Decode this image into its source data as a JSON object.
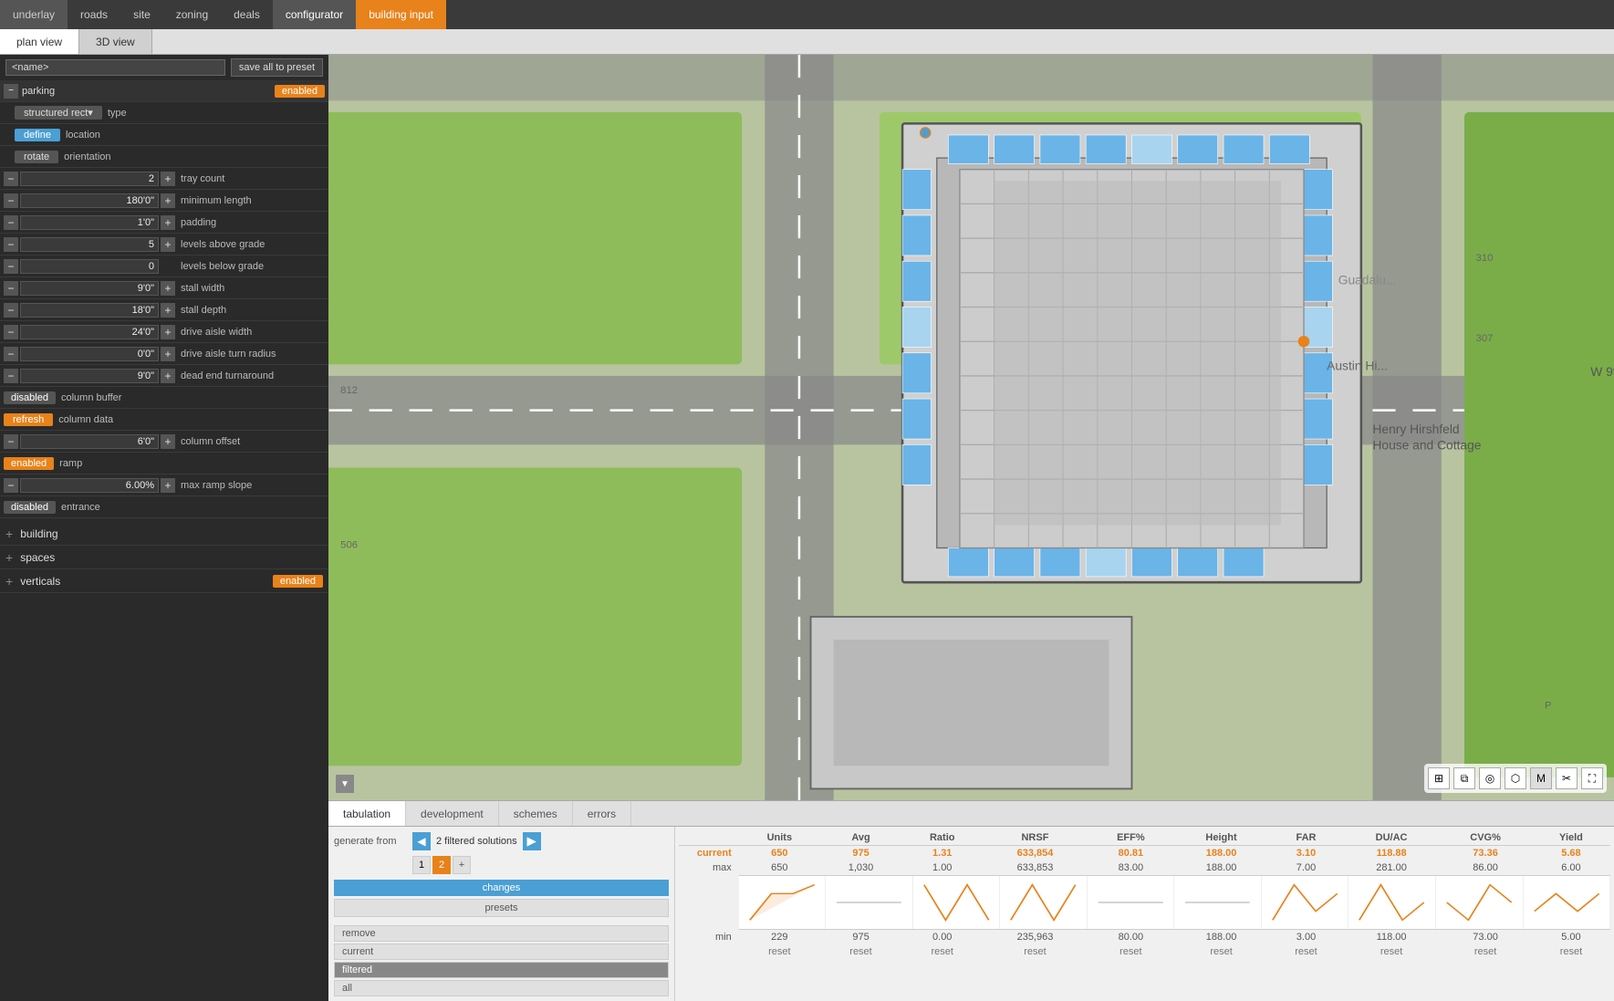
{
  "nav": {
    "items": [
      "underlay",
      "roads",
      "site",
      "zoning",
      "deals"
    ],
    "active": "configurator",
    "building_input_label": "building input"
  },
  "tabs": {
    "items": [
      "plan view",
      "3D view"
    ],
    "active": "plan view"
  },
  "left_panel": {
    "name_placeholder": "<name>",
    "save_label": "save all to preset",
    "parking": {
      "label": "parking",
      "enabled": "enabled",
      "structured_rect": "structured rect▾",
      "type_label": "type",
      "location_label": "location",
      "define_label": "define",
      "rotate_label": "rotate",
      "orientation_label": "orientation",
      "tray_count_label": "tray count",
      "tray_count_value": "2",
      "min_length_label": "minimum length",
      "min_length_value": "180'0\"",
      "padding_label": "padding",
      "padding_value": "1'0\"",
      "levels_above_label": "levels above grade",
      "levels_above_value": "5",
      "levels_below_label": "levels below grade",
      "levels_below_value": "0",
      "stall_width_label": "stall width",
      "stall_width_value": "9'0\"",
      "stall_depth_label": "stall depth",
      "stall_depth_value": "18'0\"",
      "drive_aisle_label": "drive aisle width",
      "drive_aisle_value": "24'0\"",
      "turn_radius_label": "drive aisle turn radius",
      "turn_radius_value": "0'0\"",
      "dead_end_label": "dead end turnaround",
      "dead_end_value": "9'0\"",
      "col_buffer_label": "column buffer",
      "col_buffer_status": "disabled",
      "col_data_label": "column data",
      "col_data_status": "refresh",
      "col_offset_label": "column offset",
      "col_offset_value": "6'0\"",
      "ramp_label": "ramp",
      "ramp_status": "enabled",
      "max_ramp_label": "max ramp slope",
      "max_ramp_value": "6.00%",
      "entrance_label": "entrance",
      "entrance_status": "disabled"
    },
    "building": {
      "label": "building"
    },
    "spaces": {
      "label": "spaces"
    },
    "verticals": {
      "label": "verticals",
      "status": "enabled"
    }
  },
  "bottom_panel": {
    "tabs": [
      "tabulation",
      "development",
      "schemes",
      "errors"
    ],
    "active": "tabulation",
    "generate_from_label": "generate from",
    "filtered_solutions_label": "2 filtered solutions",
    "changes_label": "changes",
    "presets_label": "presets",
    "remove_label": "remove",
    "current_label": "current",
    "filtered_label": "filtered",
    "all_label": "all",
    "solution_pills": [
      "1",
      "2"
    ],
    "table": {
      "headers": [
        "",
        "Units",
        "Avg",
        "Ratio",
        "NRSF",
        "EFF%",
        "Height",
        "FAR",
        "DU/AC",
        "CVG%",
        "Yield"
      ],
      "rows": [
        {
          "label": "current",
          "values": [
            "650",
            "975",
            "1.31",
            "633,854",
            "80.81",
            "188.00",
            "3.10",
            "118.88",
            "73.36",
            "5.68"
          ]
        },
        {
          "label": "max",
          "values": [
            "650",
            "1,030",
            "1.00",
            "633,853",
            "83.00",
            "188.00",
            "7.00",
            "281.00",
            "86.00",
            "6.00"
          ]
        },
        {
          "label": "min",
          "values": [
            "229",
            "975",
            "0.00",
            "235,963",
            "80.00",
            "188.00",
            "3.00",
            "118.00",
            "73.00",
            "5.00"
          ]
        },
        {
          "label": "reset",
          "values": [
            "reset",
            "reset",
            "reset",
            "reset",
            "reset",
            "reset",
            "reset",
            "reset",
            "reset",
            "reset"
          ]
        }
      ]
    }
  },
  "icons": {
    "grid_icon": "⊞",
    "layers_icon": "⧉",
    "target_icon": "◎",
    "shape_icon": "⬡",
    "measure_icon": "M",
    "scissors_icon": "✂",
    "fullscreen_icon": "⛶",
    "chevron_left": "◀",
    "chevron_right": "▶"
  }
}
